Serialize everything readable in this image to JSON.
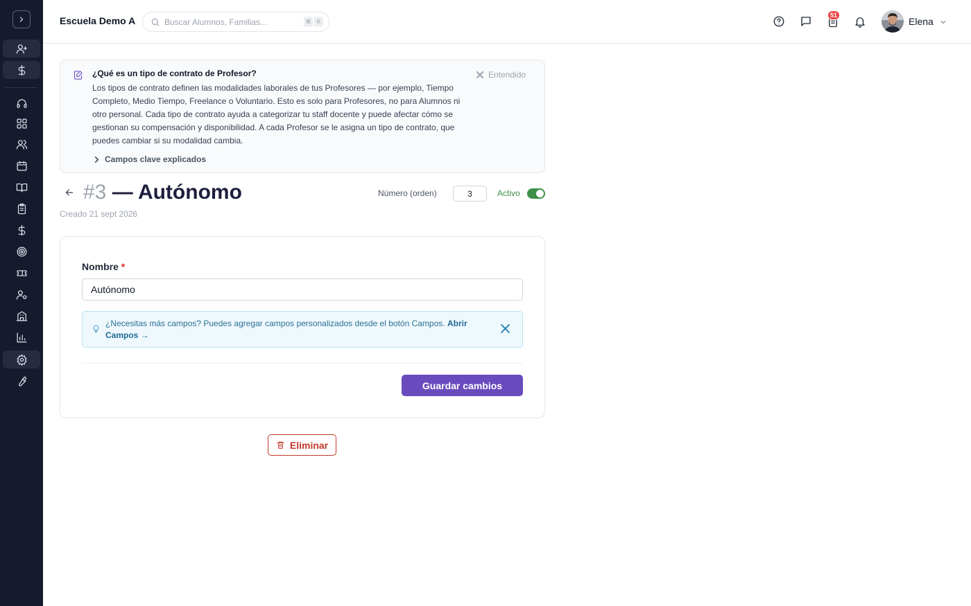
{
  "topbar": {
    "school_name": "Escuela Demo A",
    "search_placeholder": "Buscar Alumnos, Familias...",
    "shortcut_keys": [
      "⌘",
      "K"
    ],
    "notification_count": "51",
    "user_name": "Elena"
  },
  "sidebar": {
    "icons": [
      "chevron-right-icon",
      "user-plus-icon",
      "dollar-icon",
      "headset-icon",
      "dashboard-icon",
      "users-icon",
      "calendar-icon",
      "book-icon",
      "clipboard-icon",
      "dollar-icon",
      "target-icon",
      "ticket-icon",
      "user-cog-icon",
      "building-icon",
      "bar-chart-icon",
      "gear-icon",
      "wrench-icon"
    ]
  },
  "info": {
    "title": "¿Qué es un tipo de contrato de Profesor?",
    "body": "Los tipos de contrato definen las modalidades laborales de tus Profesores — por ejemplo, Tiempo Completo, Medio Tiempo, Freelance o Voluntario. Esto es solo para Profesores, no para Alumnos ni otro personal. Cada tipo de contrato ayuda a categorizar tu staff docente y puede afectar cómo se gestionan su compensación y disponibilidad. A cada Profesor se le asigna un tipo de contrato, que puedes cambiar si su modalidad cambia.",
    "dismiss_label": "Entendido",
    "more_label": "Campos clave explicados"
  },
  "header": {
    "number": "#3",
    "title": "— Autónomo",
    "created": "Creado 21 sept 2026",
    "order_label": "Número (orden)",
    "order_value": "3",
    "active_label": "Activo"
  },
  "form": {
    "name_label": "Nombre",
    "required_mark": "*",
    "name_value": "Autónomo",
    "tip_text": "¿Necesitas más campos? Puedes agregar campos personalizados desde el botón Campos.",
    "tip_link": "Abrir Campos →",
    "save_label": "Guardar cambios"
  },
  "delete_label": "Eliminar",
  "colors": {
    "sidebar_bg": "#161a2e",
    "accent": "#6a4bbd",
    "active_green": "#3f8f4a",
    "danger": "#c0392b",
    "badge_red": "#ef4444"
  }
}
